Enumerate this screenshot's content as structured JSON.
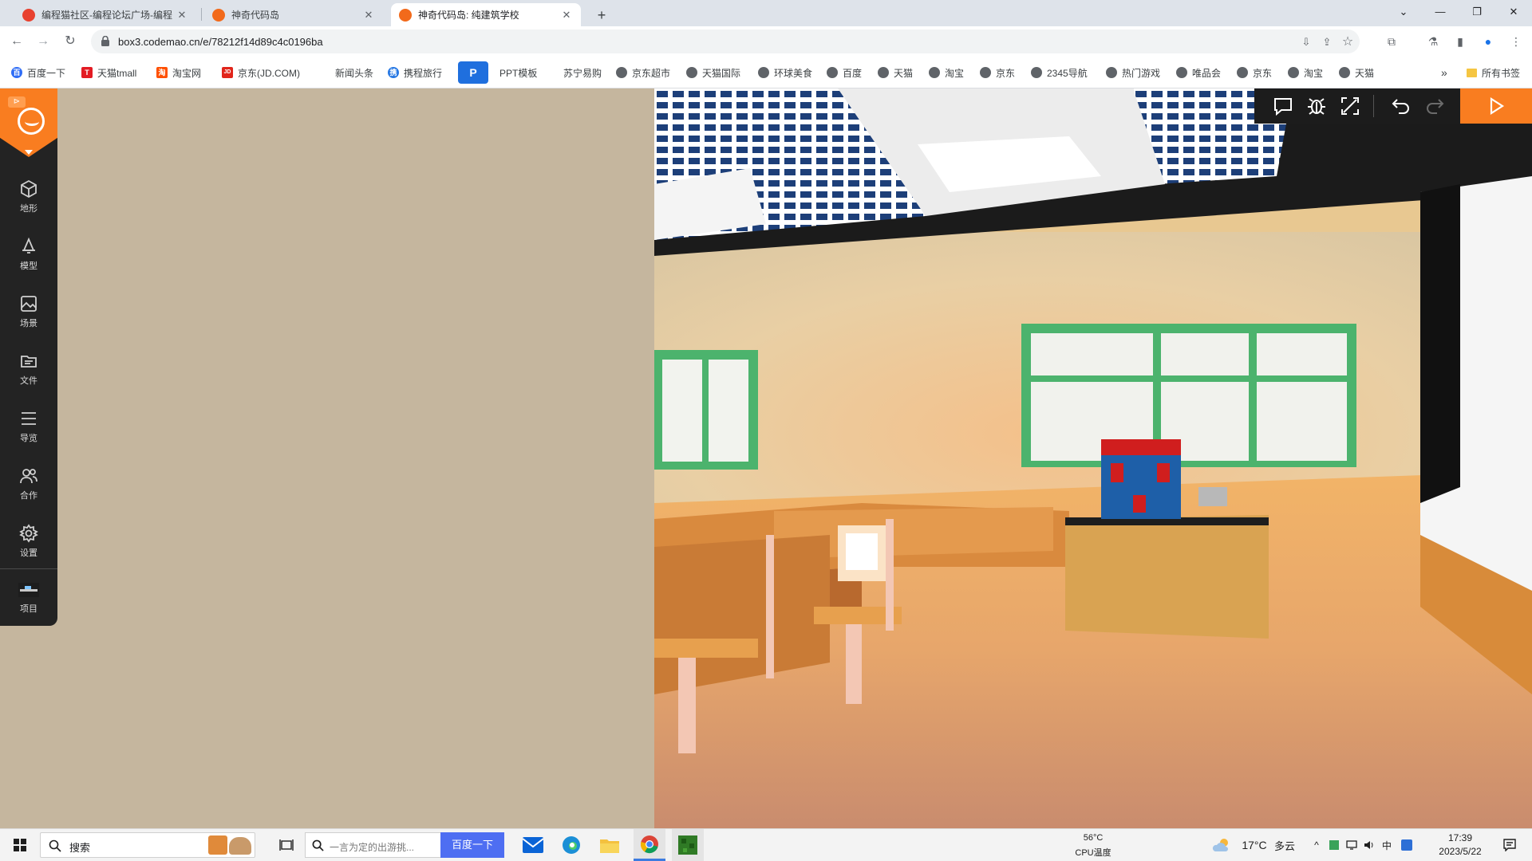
{
  "browser": {
    "tabs": [
      {
        "title": "编程猫社区-编程论坛广场-编程",
        "favicon": "#e8412f",
        "active": false
      },
      {
        "title": "神奇代码岛",
        "favicon": "#f26a1b",
        "active": false
      },
      {
        "title": "神奇代码岛: 纯建筑学校",
        "favicon": "#f26a1b",
        "active": true
      }
    ],
    "new_tab": "+",
    "window_controls": {
      "tab_search": "⌄",
      "minimize": "—",
      "restore": "❐",
      "close": "✕"
    },
    "nav": {
      "back": "←",
      "forward": "→",
      "reload": "↻"
    },
    "url": "box3.codemao.cn/e/78212f14d89c4c0196ba",
    "omnibox_icons": {
      "install": "⇩",
      "share": "⇪",
      "star": "☆"
    },
    "toolbar_icons": {
      "extensions": "⧉",
      "labs": "⚗",
      "sidepanel": "▮",
      "profile": "●",
      "menu": "⋮"
    }
  },
  "bookmarks": [
    {
      "label": "百度一下",
      "color": "#2f6df6",
      "glyph": "百"
    },
    {
      "label": "天猫tmall",
      "color": "#e31b23",
      "glyph": "T"
    },
    {
      "label": "淘宝网",
      "color": "#ff5000",
      "glyph": "淘"
    },
    {
      "label": "京东(JD.COM)",
      "color": "#e1251b",
      "glyph": "JD"
    },
    {
      "label": "新闻头条",
      "color": "",
      "glyph": ""
    },
    {
      "label": "携程旅行",
      "color": "#2577e3",
      "glyph": "携"
    },
    {
      "label": "PPT模板",
      "color": "#1f6fde",
      "glyph": "P"
    },
    {
      "label": "苏宁易购",
      "color": "",
      "glyph": ""
    },
    {
      "label": "京东超市",
      "color": "#5f6368",
      "glyph": ""
    },
    {
      "label": "天猫国际",
      "color": "#5f6368",
      "glyph": ""
    },
    {
      "label": "环球美食",
      "color": "#5f6368",
      "glyph": ""
    },
    {
      "label": "百度",
      "color": "#5f6368",
      "glyph": ""
    },
    {
      "label": "天猫",
      "color": "#5f6368",
      "glyph": ""
    },
    {
      "label": "淘宝",
      "color": "#5f6368",
      "glyph": ""
    },
    {
      "label": "京东",
      "color": "#5f6368",
      "glyph": ""
    },
    {
      "label": "2345导航",
      "color": "#5f6368",
      "glyph": ""
    },
    {
      "label": "热门游戏",
      "color": "#5f6368",
      "glyph": ""
    },
    {
      "label": "唯品会",
      "color": "#5f6368",
      "glyph": ""
    },
    {
      "label": "京东",
      "color": "#5f6368",
      "glyph": ""
    },
    {
      "label": "淘宝",
      "color": "#5f6368",
      "glyph": ""
    },
    {
      "label": "天猫",
      "color": "#5f6368",
      "glyph": ""
    }
  ],
  "bookmarks_overflow": "»",
  "all_bookmarks": "所有书签",
  "editor": {
    "brand_color": "#f97d20",
    "logo_tag": "⊳",
    "sidebar": [
      {
        "label": "地形",
        "icon": "cube-icon"
      },
      {
        "label": "模型",
        "icon": "bell-model-icon"
      },
      {
        "label": "场景",
        "icon": "image-icon"
      },
      {
        "label": "文件",
        "icon": "file-icon"
      },
      {
        "label": "导览",
        "icon": "list-icon"
      },
      {
        "label": "合作",
        "icon": "users-icon"
      },
      {
        "label": "设置",
        "icon": "gear-icon"
      },
      {
        "label": "项目",
        "icon": "project-thumbnail-icon"
      }
    ],
    "viewport_toolbar": [
      "chat-icon",
      "debug-bug-icon",
      "fullscreen-icon",
      "undo-icon",
      "redo-icon",
      "play-icon"
    ]
  },
  "taskbar": {
    "search_label": "搜索",
    "web_search_placeholder": "一言为定的出游挑...",
    "web_search_button": "百度一下",
    "cpu_temp": "56°C",
    "cpu_label": "CPU温度",
    "weather_temp": "17°C",
    "weather_desc": "多云",
    "time": "17:39",
    "date": "2023/5/22",
    "ime": "中",
    "tray_up": "^"
  }
}
